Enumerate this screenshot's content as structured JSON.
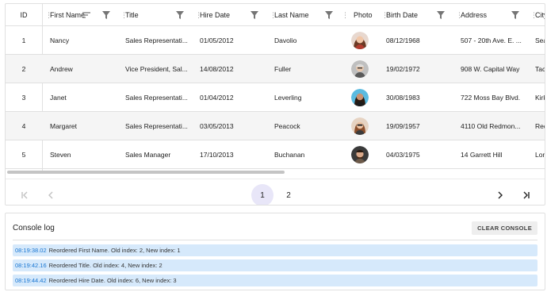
{
  "grid": {
    "columns": [
      {
        "key": "id",
        "label": "ID"
      },
      {
        "key": "first_name",
        "label": "First Name"
      },
      {
        "key": "title",
        "label": "Title"
      },
      {
        "key": "hire_date",
        "label": "Hire Date"
      },
      {
        "key": "last_name",
        "label": "Last Name"
      },
      {
        "key": "photo",
        "label": "Photo"
      },
      {
        "key": "birth_date",
        "label": "Birth Date"
      },
      {
        "key": "address",
        "label": "Address"
      },
      {
        "key": "city",
        "label": "City"
      }
    ],
    "rows": [
      {
        "id": "1",
        "first_name": "Nancy",
        "title": "Sales Representati...",
        "hire_date": "01/05/2012",
        "last_name": "Davolio",
        "photo": "photo-nancy",
        "birth_date": "08/12/1968",
        "address": "507 - 20th Ave. E. ...",
        "city": "Sea"
      },
      {
        "id": "2",
        "first_name": "Andrew",
        "title": "Vice President, Sal...",
        "hire_date": "14/08/2012",
        "last_name": "Fuller",
        "photo": "photo-andrew",
        "birth_date": "19/02/1972",
        "address": "908 W. Capital Way",
        "city": "Tac"
      },
      {
        "id": "3",
        "first_name": "Janet",
        "title": "Sales Representati...",
        "hire_date": "01/04/2012",
        "last_name": "Leverling",
        "photo": "photo-janet",
        "birth_date": "30/08/1983",
        "address": "722 Moss Bay Blvd.",
        "city": "Kirk"
      },
      {
        "id": "4",
        "first_name": "Margaret",
        "title": "Sales Representati...",
        "hire_date": "03/05/2013",
        "last_name": "Peacock",
        "photo": "photo-margaret",
        "birth_date": "19/09/1957",
        "address": "4110 Old Redmon...",
        "city": "Red"
      },
      {
        "id": "5",
        "first_name": "Steven",
        "title": "Sales Manager",
        "hire_date": "17/10/2013",
        "last_name": "Buchanan",
        "photo": "photo-steven",
        "birth_date": "04/03/1975",
        "address": "14 Garrett Hill",
        "city": "Lon"
      }
    ]
  },
  "pager": {
    "pages": [
      "1",
      "2"
    ],
    "current_page": "1"
  },
  "console": {
    "title": "Console log",
    "clear_label": "CLEAR CONSOLE",
    "entries": [
      {
        "time": "08:19:38.02",
        "message": "Reordered First Name. Old index: 2, New index: 1"
      },
      {
        "time": "08:19:42.16",
        "message": "Reordered Title. Old index: 4, New index: 2"
      },
      {
        "time": "08:19:44.42",
        "message": "Reordered Hire Date. Old index: 6, New index: 3"
      }
    ]
  },
  "colors": {
    "accent": "#1976d2",
    "active_page_bg": "#e8e6f8",
    "log_bg": "#d6e9fb",
    "alt_row_bg": "#f5f5f5"
  }
}
